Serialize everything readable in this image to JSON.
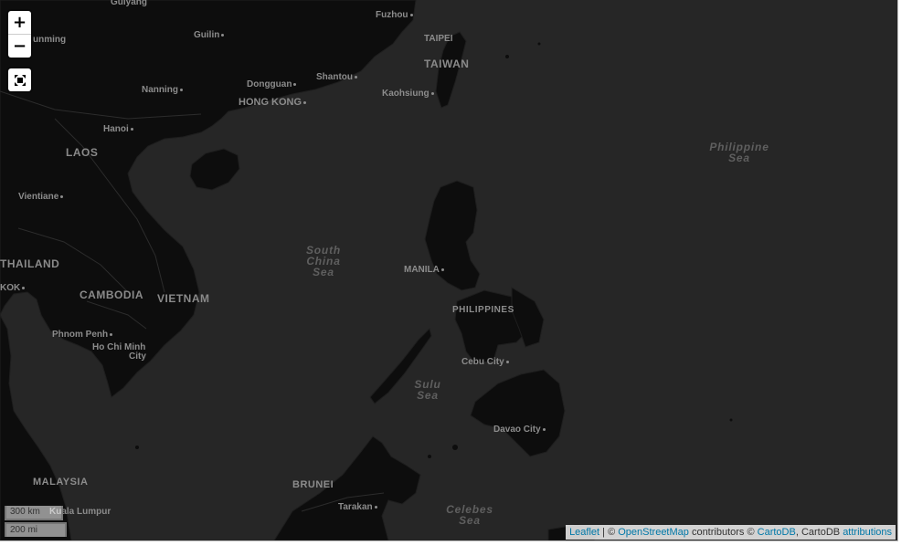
{
  "controls": {
    "zoom_in": "+",
    "zoom_out": "−",
    "fullscreen_icon": "fullscreen-icon"
  },
  "scale": {
    "km": "300 km",
    "mi": "200 mi"
  },
  "attribution": {
    "leaflet": "Leaflet",
    "sep1": " | © ",
    "osm": "OpenStreetMap",
    "mid": " contributors © ",
    "cartodb": "CartoDB",
    "mid2": ", CartoDB ",
    "attributions": "attributions"
  },
  "colors": {
    "land": "#0d0d0d",
    "sea": "#262626",
    "label": "#8c8c8c",
    "link": "#0078a8"
  },
  "labels": {
    "guiyang": "Guiyang",
    "kunming": "unming",
    "guilin": "Guilin",
    "fuzhou": "Fuzhou",
    "taipei": "TAIPEI",
    "taiwan": "TAIWAN",
    "nanning": "Nanning",
    "dongguan": "Dongguan",
    "shantou": "Shantou",
    "kaohsiung": "Kaohsiung",
    "hong_kong": "HONG KONG",
    "hanoi": "Hanoi",
    "laos": "LAOS",
    "vientiane": "Vientiane",
    "thailand": "THAILAND",
    "bangkok": "KOK",
    "cambodia": "CAMBODIA",
    "vietnam": "VIETNAM",
    "phnom_penh": "Phnom Penh",
    "hcmc_1": "Ho Chi Minh",
    "hcmc_2": "City",
    "manila": "MANILA",
    "philippines": "PHILIPPINES",
    "cebu": "Cebu City",
    "davao": "Davao City",
    "malaysia": "MALAYSIA",
    "kuala_lumpur": "Kuala Lumpur",
    "brunei": "BRUNEI",
    "tarakan": "Tarakan",
    "south_china_sea": [
      "South",
      "China",
      "Sea"
    ],
    "philippine_sea": [
      "Philippine",
      "Sea"
    ],
    "sulu_sea": [
      "Sulu",
      "Sea"
    ],
    "celebes_sea": [
      "Celebes",
      "Sea"
    ]
  }
}
